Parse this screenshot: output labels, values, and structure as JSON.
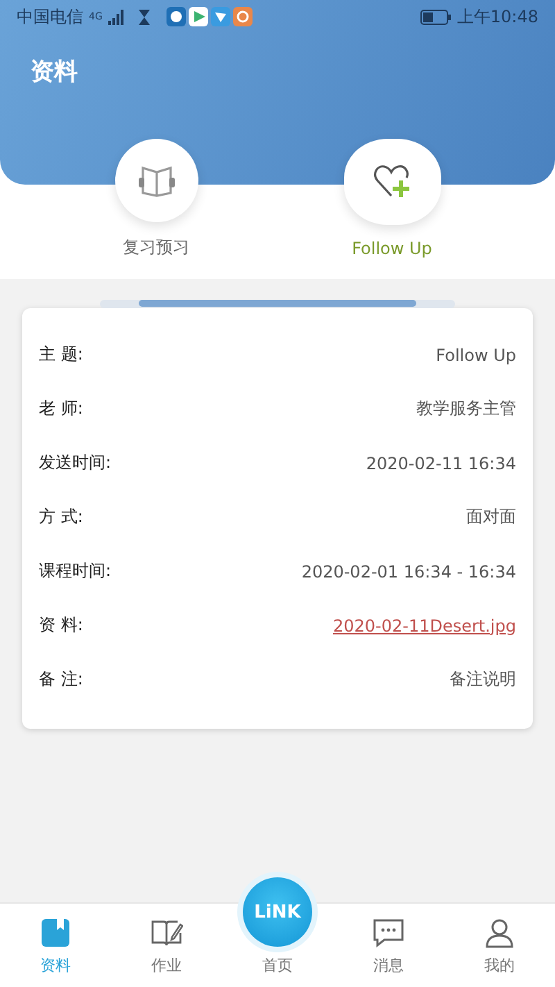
{
  "status_bar": {
    "carrier": "中国电信",
    "network": "4G",
    "time": "上午10:48"
  },
  "header": {
    "title": "资料"
  },
  "categories": [
    {
      "label": "复习预习",
      "kind": "book",
      "selected": false
    },
    {
      "label": "Follow Up",
      "kind": "heart",
      "selected": true
    }
  ],
  "details": [
    {
      "label": "主 题:",
      "value": "Follow Up",
      "kind": "text"
    },
    {
      "label": "老 师:",
      "value": "教学服务主管",
      "kind": "text"
    },
    {
      "label": "发送时间:",
      "value": "2020-02-11 16:34",
      "kind": "text"
    },
    {
      "label": "方 式:",
      "value": "面对面",
      "kind": "text"
    },
    {
      "label": "课程时间:",
      "value": "2020-02-01 16:34 - 16:34",
      "kind": "text"
    },
    {
      "label": "资 料:",
      "value": "2020-02-11Desert.jpg",
      "kind": "link"
    },
    {
      "label": "备 注:",
      "value": "备注说明",
      "kind": "text"
    }
  ],
  "bottom_nav": [
    {
      "label": "资料",
      "kind": "material",
      "selected": true
    },
    {
      "label": "作业",
      "kind": "homework",
      "selected": false
    },
    {
      "label": "首页",
      "kind": "home",
      "badge": "LiNK",
      "selected": false
    },
    {
      "label": "消息",
      "kind": "message",
      "selected": false
    },
    {
      "label": "我的",
      "kind": "profile",
      "selected": false
    }
  ]
}
